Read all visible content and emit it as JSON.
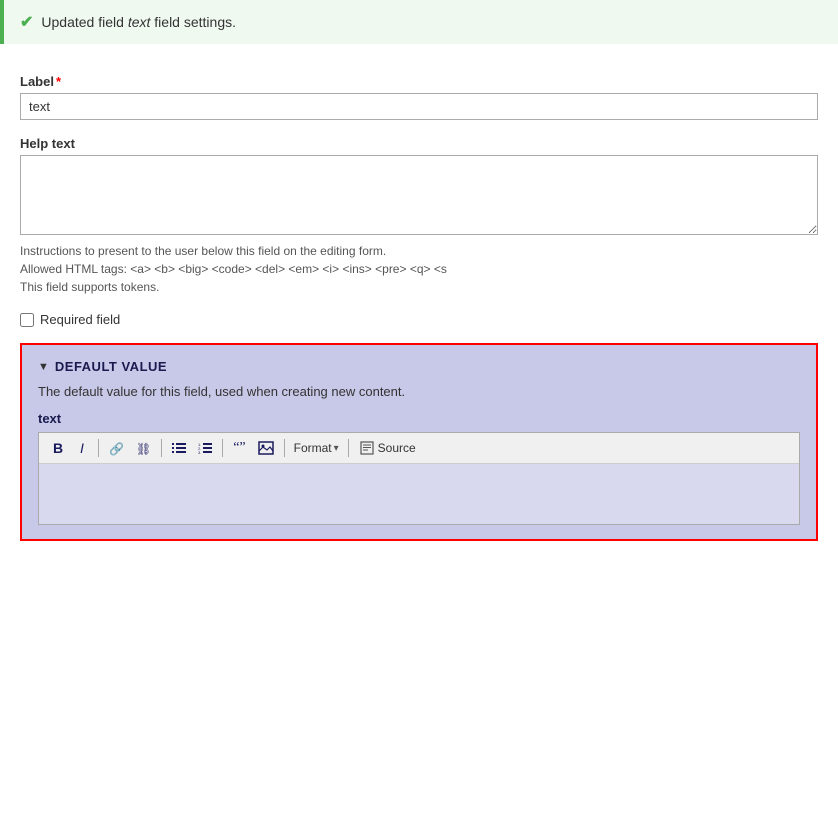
{
  "success_banner": {
    "icon": "✔",
    "text_before": "Updated field ",
    "text_italic": "text",
    "text_after": " field settings."
  },
  "form": {
    "label_field": {
      "label": "Label",
      "required_marker": "*",
      "value": "text"
    },
    "help_text_field": {
      "label": "Help text",
      "value": "",
      "placeholder": ""
    },
    "hints": {
      "line1": "Instructions to present to the user below this field on the editing form.",
      "line2": "Allowed HTML tags: <a> <b> <big> <code> <del> <em> <i> <ins> <pre> <q> <s",
      "line3": "This field supports tokens."
    },
    "required_field": {
      "label": "Required field"
    }
  },
  "default_value_section": {
    "toggle": "▼",
    "title": "DEFAULT VALUE",
    "description": "The default value for this field, used when creating new content.",
    "editor_label": "text",
    "toolbar": {
      "bold": "B",
      "italic": "I",
      "link": "link-icon",
      "unlink": "unlink-icon",
      "unordered_list": "ul-icon",
      "ordered_list": "ol-icon",
      "blockquote": "blockquote-icon",
      "image": "image-icon",
      "format_label": "Format",
      "format_arrow": "▾",
      "source_icon": "source-icon",
      "source_label": "Source"
    }
  }
}
